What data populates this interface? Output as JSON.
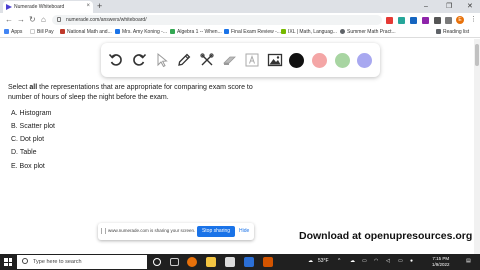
{
  "browser": {
    "tab_title": "Numerade Whiteboard",
    "tab_close": "×",
    "new_tab": "+",
    "url": "numerade.com/answers/whiteboard/",
    "nav": {
      "back": "←",
      "forward": "→",
      "reload": "↻",
      "home": "⌂"
    },
    "profile_initial": "E",
    "menu": "⋮",
    "window_controls": {
      "minimize": "–",
      "maximize": "❐",
      "close": "✕"
    }
  },
  "bookmarks": [
    {
      "label": "Apps",
      "color": "#4285f4"
    },
    {
      "label": "Bill Pay",
      "color": "#ffffff"
    },
    {
      "label": "National Math and...",
      "color": "#c0392b"
    },
    {
      "label": "Mrs. Amy Koning -...",
      "color": "#1a73e8"
    },
    {
      "label": "Algebra 1 -- When...",
      "color": "#34a853"
    },
    {
      "label": "Final Exam Review -...",
      "color": "#1a73e8"
    },
    {
      "label": "IXL | Math, Languag...",
      "color": "#76b900"
    },
    {
      "label": "Summer Math Pract...",
      "color": "#5f6368"
    }
  ],
  "reading_list": "Reading list",
  "whiteboard": {
    "tools": [
      "undo-icon",
      "redo-icon",
      "pointer-icon",
      "pen-icon",
      "tools-icon",
      "eraser-icon",
      "text-icon",
      "image-icon"
    ],
    "colors": [
      "#111111",
      "#f4a6a6",
      "#a8d5a2",
      "#a8a8f0"
    ]
  },
  "question": {
    "prefix": "Select ",
    "bold": "all",
    "suffix": " the representations that are appropriate for comparing exam score to number of hours of sleep the night before the exam.",
    "options": [
      "A. Histogram",
      "B. Scatter plot",
      "C. Dot plot",
      "D. Table",
      "E. Box plot"
    ]
  },
  "share_bar": {
    "message": "www.numerade.com is sharing your screen.",
    "stop_label": "Stop sharing",
    "hide_label": "Hide"
  },
  "watermark": "Download at openupresources.org",
  "taskbar": {
    "search_placeholder": "Type here to search",
    "weather": "53°F",
    "time": "7:15 PM",
    "date": "1/9/2022"
  }
}
